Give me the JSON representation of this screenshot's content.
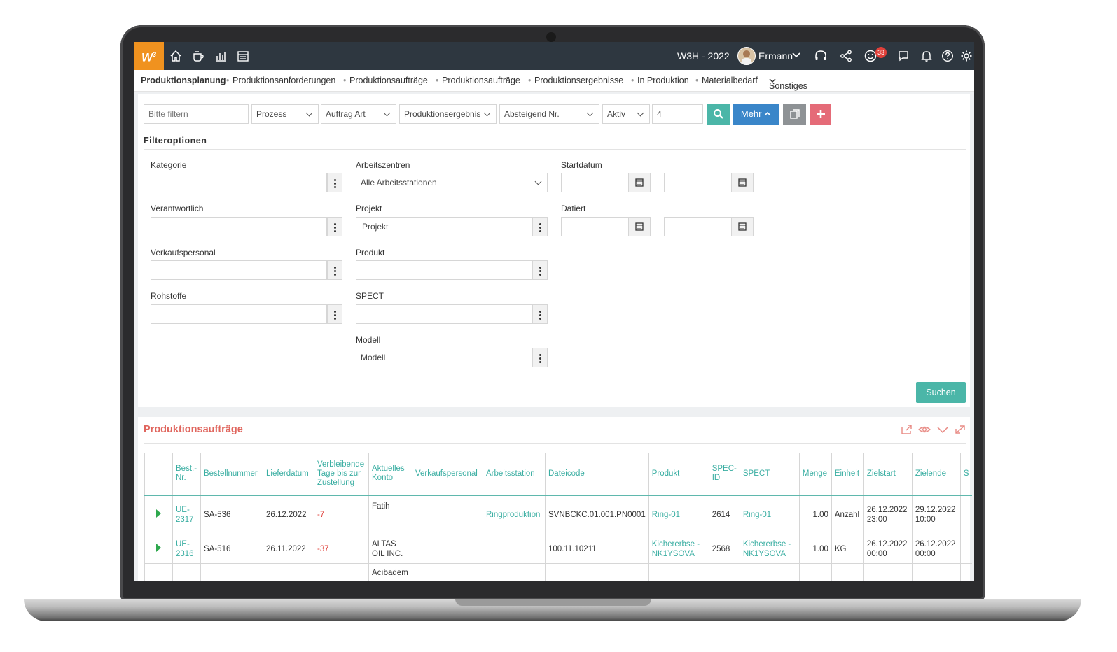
{
  "topbar": {
    "logo": "W",
    "logo_sup": "3",
    "company": "W3H - 2022",
    "user": "Ermann",
    "notification_count": "33"
  },
  "nav": {
    "items": [
      "Produktionsplanung",
      "Produktionsanforderungen",
      "Produktionsaufträge",
      "Produktionsaufträge",
      "Produktionsergebnisse",
      "In Produktion",
      "Materialbedarf"
    ],
    "more": "Sonstiges"
  },
  "filterbar": {
    "search_placeholder": "Bitte filtern",
    "prozess": "Prozess",
    "auftrag_art": "Auftrag Art",
    "produktionsergebnis": "Produktionsergebnis",
    "sort": "Absteigend Nr.",
    "status": "Aktiv",
    "count": "4",
    "mehr": "Mehr"
  },
  "filteroptions": {
    "title": "Filteroptionen",
    "kategorie": "Kategorie",
    "verantwortlich": "Verantwortlich",
    "verkaufspersonal": "Verkaufspersonal",
    "rohstoffe": "Rohstoffe",
    "arbeitszentren": "Arbeitszentren",
    "arbeitszentren_value": "Alle Arbeitsstationen",
    "projekt": "Projekt",
    "projekt_value": "Projekt",
    "produkt": "Produkt",
    "spect": "SPECT",
    "modell": "Modell",
    "modell_value": "Modell",
    "startdatum": "Startdatum",
    "datiert": "Datiert",
    "suchen": "Suchen"
  },
  "orders": {
    "title": "Produktionsaufträge",
    "headers": [
      "Best.-Nr.",
      "Bestellnummer",
      "Lieferdatum",
      "Verbleibende Tage bis zur Zustellung",
      "Aktuelles Konto",
      "Verkaufspersonal",
      "Arbeitsstation",
      "Dateicode",
      "Produkt",
      "SPEC-ID",
      "SPECT",
      "Menge",
      "Einheit",
      "Zielstart",
      "Zielende",
      "S"
    ],
    "rows": [
      {
        "nr": "UE-2317",
        "bestellnummer": "SA-536",
        "lieferdatum": "26.12.2022",
        "tage": "-7",
        "konto": "Fatih",
        "verkauf": "",
        "station": "Ringproduktion",
        "dateicode": "SVNBCKC.01.001.PN0001",
        "produkt": "Ring-01",
        "specid": "2614",
        "spect": "Ring-01",
        "menge": "1.00",
        "einheit": "Anzahl",
        "zielstart": "26.12.2022 23:00",
        "zielende": "29.12.2022 10:00"
      },
      {
        "nr": "UE-2316",
        "bestellnummer": "SA-516",
        "lieferdatum": "26.11.2022",
        "tage": "-37",
        "konto": "ALTAS OIL INC.",
        "verkauf": "",
        "station": "",
        "dateicode": "100.11.10211",
        "produkt": "Kichererbse - NK1YSOVA",
        "specid": "2568",
        "spect": "Kichererbse - NK1YSOVA",
        "menge": "1.00",
        "einheit": "KG",
        "zielstart": "26.12.2022 00:00",
        "zielende": "26.12.2022 00:00"
      },
      {
        "konto": "Acıbadem"
      }
    ]
  }
}
